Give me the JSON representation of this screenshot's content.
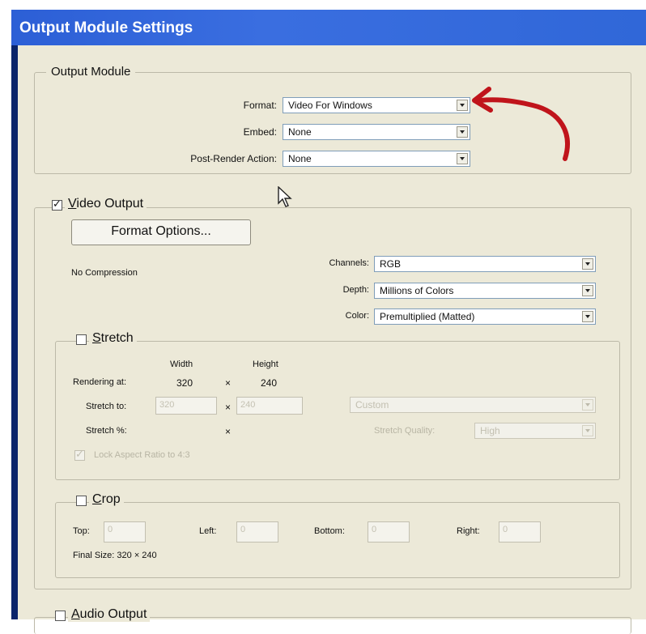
{
  "window": {
    "title": "Output Module Settings"
  },
  "output_module": {
    "legend": "Output Module",
    "format": {
      "label": "Format:",
      "value": "Video For Windows"
    },
    "embed": {
      "label": "Embed:",
      "value": "None"
    },
    "post_render": {
      "label": "Post-Render Action:",
      "value": "None"
    }
  },
  "video_output": {
    "label": "Video Output",
    "checked": true,
    "format_options_button": "Format Options...",
    "compression": "No Compression",
    "channels": {
      "label": "Channels:",
      "value": "RGB"
    },
    "depth": {
      "label": "Depth:",
      "value": "Millions of Colors"
    },
    "color": {
      "label": "Color:",
      "value": "Premultiplied (Matted)"
    }
  },
  "stretch": {
    "label": "Stretch",
    "checked": false,
    "width_header": "Width",
    "height_header": "Height",
    "rendering_label": "Rendering at:",
    "rendering_width": "320",
    "rendering_height": "240",
    "times": "×",
    "stretch_to_label": "Stretch to:",
    "stretch_to_width": "320",
    "stretch_to_height": "240",
    "stretch_percent_label": "Stretch %:",
    "preset": "Custom",
    "quality_label": "Stretch Quality:",
    "quality_value": "High",
    "lock_aspect": "Lock Aspect Ratio to 4:3"
  },
  "crop": {
    "label": "Crop",
    "checked": false,
    "top_label": "Top:",
    "left_label": "Left:",
    "bottom_label": "Bottom:",
    "right_label": "Right:",
    "top": "0",
    "left": "0",
    "bottom": "0",
    "right": "0",
    "final_size": "Final Size: 320 × 240"
  },
  "audio_output": {
    "label": "Audio Output",
    "checked": false
  },
  "annotation": {
    "arrow_color": "#c0141b"
  }
}
